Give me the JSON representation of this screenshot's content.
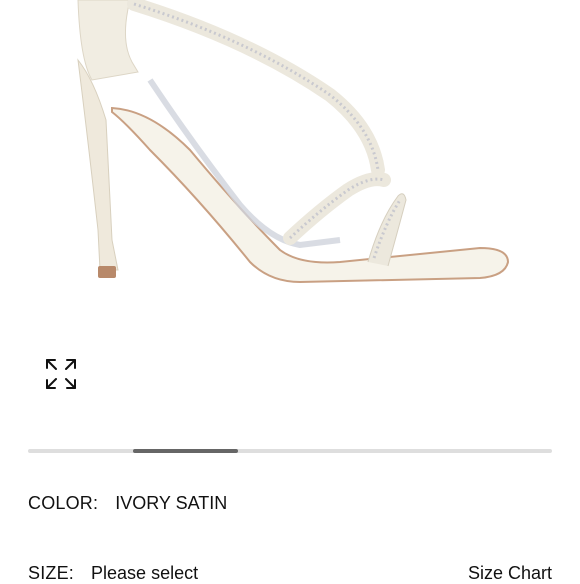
{
  "product": {
    "image_alt": "Ivory satin high heel sandal with rhinestone straps",
    "colors": {
      "satin": "#f1ede2",
      "satin_shadow": "#d9d3c4",
      "sole_edge": "#b98a69",
      "rhinestone": "#c9c9cf",
      "insole": "#f6f3ea"
    }
  },
  "gallery": {
    "expand_icon": "expand-arrows-icon",
    "slide_index": 2,
    "slide_count": 5
  },
  "color": {
    "label": "COLOR:",
    "value": "IVORY SATIN"
  },
  "size": {
    "label": "SIZE:",
    "value": "Please select",
    "chart_link": "Size Chart"
  }
}
